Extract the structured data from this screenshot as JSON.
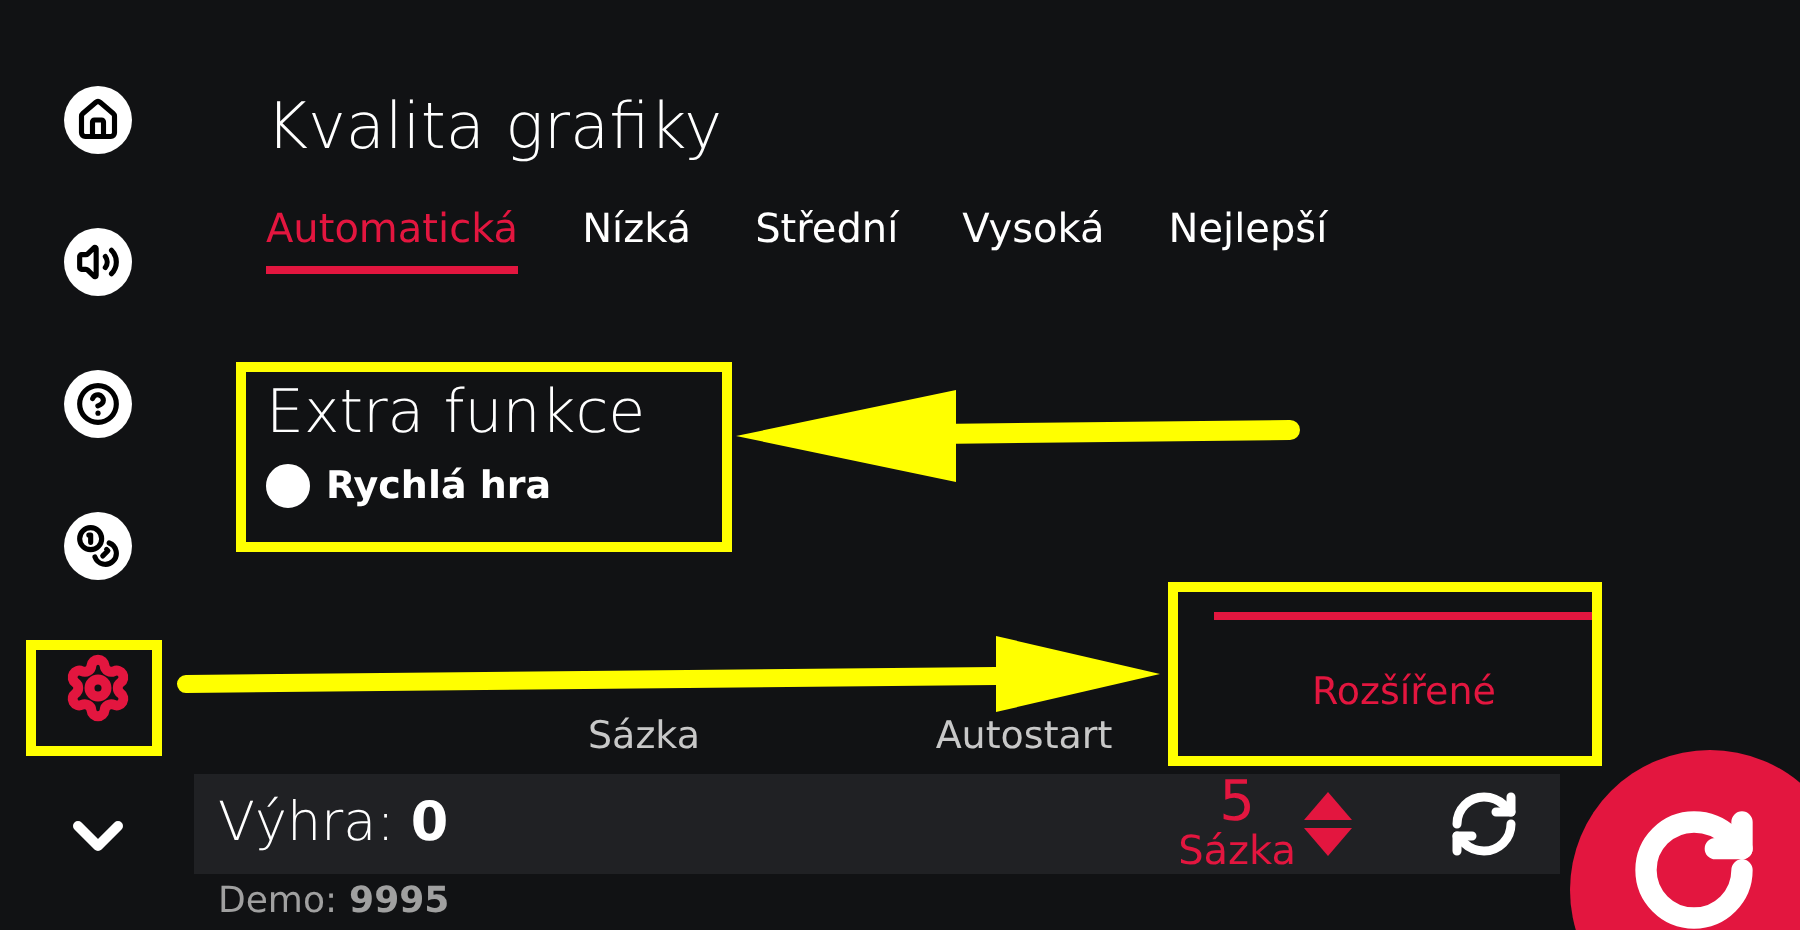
{
  "sidebar": {
    "items": [
      {
        "kind": "home",
        "selected": false
      },
      {
        "kind": "sound",
        "selected": false
      },
      {
        "kind": "help",
        "selected": false
      },
      {
        "kind": "coins",
        "selected": false
      },
      {
        "kind": "settings",
        "selected": true
      },
      {
        "kind": "more",
        "selected": false
      }
    ]
  },
  "graphics": {
    "title": "Kvalita grafiky",
    "tabs": [
      {
        "label": "Automatická",
        "selected": true
      },
      {
        "label": "Nízká",
        "selected": false
      },
      {
        "label": "Střední",
        "selected": false
      },
      {
        "label": "Vysoká",
        "selected": false
      },
      {
        "label": "Nejlepší",
        "selected": false
      }
    ]
  },
  "extra": {
    "title": "Extra funkce",
    "options": [
      {
        "label": "Rychlá hra",
        "checked": false
      }
    ]
  },
  "bottom_tabs": [
    {
      "label": "Sázka",
      "selected": false
    },
    {
      "label": "Autostart",
      "selected": false
    },
    {
      "label": "Rozšířené",
      "selected": true
    }
  ],
  "bar": {
    "win_label": "Výhra:",
    "win_value": "0",
    "bet_value": "5",
    "bet_label": "Sázka",
    "demo_label": "Demo:",
    "demo_value": "9995"
  }
}
